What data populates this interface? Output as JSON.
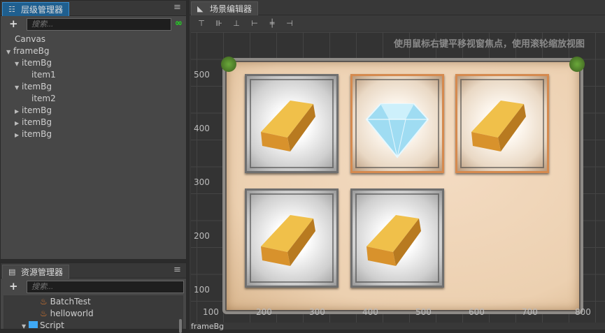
{
  "hierarchy": {
    "title": "层级管理器",
    "search_placeholder": "搜索...",
    "nodes": [
      {
        "label": "Canvas",
        "depth": 0,
        "arrow": ""
      },
      {
        "label": "frameBg",
        "depth": 0,
        "arrow": "expanded"
      },
      {
        "label": "itemBg",
        "depth": 1,
        "arrow": "expanded"
      },
      {
        "label": "item1",
        "depth": 2,
        "arrow": ""
      },
      {
        "label": "itemBg",
        "depth": 1,
        "arrow": "expanded"
      },
      {
        "label": "item2",
        "depth": 2,
        "arrow": ""
      },
      {
        "label": "itemBg",
        "depth": 1,
        "arrow": "collapsed"
      },
      {
        "label": "itemBg",
        "depth": 1,
        "arrow": "collapsed"
      },
      {
        "label": "itemBg",
        "depth": 1,
        "arrow": "collapsed"
      }
    ]
  },
  "assets": {
    "title": "资源管理器",
    "search_placeholder": "搜索...",
    "items": [
      {
        "label": "BatchTest",
        "icon": "fire-icon"
      },
      {
        "label": "helloworld",
        "icon": "fire-icon"
      },
      {
        "label": "Script",
        "icon": "folder-icon"
      }
    ]
  },
  "scene": {
    "title": "场景编辑器",
    "hint": "使用鼠标右键平移视窗焦点，使用滚轮缩放视图",
    "x_ticks": [
      "100",
      "200",
      "300",
      "400",
      "500",
      "600",
      "700",
      "800"
    ],
    "y_ticks": [
      "500",
      "400",
      "300",
      "200",
      "100"
    ],
    "cards": [
      {
        "frame": "silver",
        "item": "gold"
      },
      {
        "frame": "copper",
        "item": "diamond"
      },
      {
        "frame": "copper",
        "item": "gold"
      },
      {
        "frame": "silver",
        "item": "gold"
      },
      {
        "frame": "silver",
        "item": "gold"
      }
    ],
    "status": "frameBg"
  },
  "colors": {
    "active_tab": "#1f5f8f",
    "link_icon": "#22dd22",
    "fire_icon": "#e07a2e",
    "folder_icon": "#3fa9f5"
  }
}
